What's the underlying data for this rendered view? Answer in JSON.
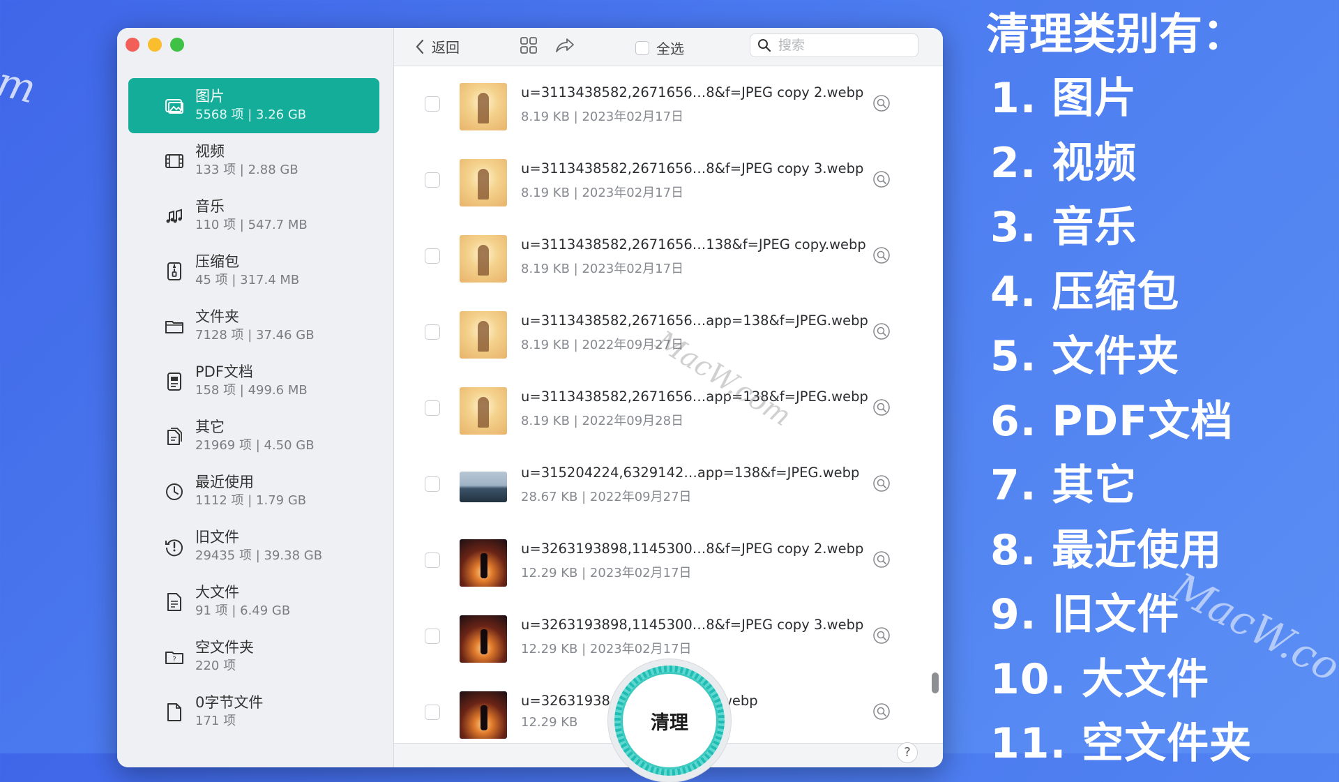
{
  "sidebar": {
    "categories": [
      {
        "name": "图片",
        "meta": "5568 项 | 3.26 GB",
        "icon": "photos-icon",
        "active": true
      },
      {
        "name": "视频",
        "meta": "133 项 | 2.88 GB",
        "icon": "film-icon"
      },
      {
        "name": "音乐",
        "meta": "110 项 | 547.7 MB",
        "icon": "music-note-icon"
      },
      {
        "name": "压缩包",
        "meta": "45 项 | 317.4 MB",
        "icon": "archive-icon"
      },
      {
        "name": "文件夹",
        "meta": "7128 项 | 37.46 GB",
        "icon": "folder-icon"
      },
      {
        "name": "PDF文档",
        "meta": "158 项 | 499.6 MB",
        "icon": "pdf-doc-icon"
      },
      {
        "name": "其它",
        "meta": "21969 项 | 4.50 GB",
        "icon": "documents-icon"
      },
      {
        "name": "最近使用",
        "meta": "1112 项 | 1.79 GB",
        "icon": "clock-icon"
      },
      {
        "name": "旧文件",
        "meta": "29435 项 | 39.38 GB",
        "icon": "history-icon"
      },
      {
        "name": "大文件",
        "meta": "91 项 | 6.49 GB",
        "icon": "large-file-icon"
      },
      {
        "name": "空文件夹",
        "meta": "220 项",
        "icon": "empty-folder-icon"
      },
      {
        "name": "0字节文件",
        "meta": "171 项",
        "icon": "zero-byte-file-icon"
      }
    ]
  },
  "toolbar": {
    "back_label": "返回",
    "select_all_label": "全选",
    "search_placeholder": "搜索"
  },
  "files": [
    {
      "name": "u=3113438582,2671656…8&f=JPEG copy 2.webp",
      "meta": "8.19 KB | 2023年02月17日",
      "thumb": "warm"
    },
    {
      "name": "u=3113438582,2671656…8&f=JPEG copy 3.webp",
      "meta": "8.19 KB | 2023年02月17日",
      "thumb": "warm"
    },
    {
      "name": "u=3113438582,2671656…138&f=JPEG copy.webp",
      "meta": "8.19 KB | 2023年02月17日",
      "thumb": "warm"
    },
    {
      "name": "u=3113438582,2671656…app=138&f=JPEG.webp",
      "meta": "8.19 KB | 2022年09月27日",
      "thumb": "warm"
    },
    {
      "name": "u=3113438582,2671656…app=138&f=JPEG.webp",
      "meta": "8.19 KB | 2022年09月28日",
      "thumb": "warm"
    },
    {
      "name": "u=315204224,6329142…app=138&f=JPEG.webp",
      "meta": "28.67 KB | 2022年09月27日",
      "thumb": "sea"
    },
    {
      "name": "u=3263193898,1145300…8&f=JPEG copy 2.webp",
      "meta": "12.29 KB | 2023年02月17日",
      "thumb": "sunset"
    },
    {
      "name": "u=3263193898,1145300…8&f=JPEG copy 3.webp",
      "meta": "12.29 KB | 2023年02月17日",
      "thumb": "sunset"
    },
    {
      "name": "u=32631938…&f=JPEG copy.webp",
      "meta": "12.29 KB",
      "thumb": "sunset"
    }
  ],
  "clean_button_label": "清理",
  "help_label": "?",
  "watermarks": {
    "left": "m",
    "middle": "MacW.com",
    "right": "MacW.co"
  },
  "right_panel": {
    "title": "清理类别有：",
    "items": [
      "1. 图片",
      "2. 视频",
      "3. 音乐",
      "4. 压缩包",
      "5. 文件夹",
      "6. PDF文档",
      "7. 其它",
      "8. 最近使用",
      "9. 旧文件",
      "10. 大文件",
      "11. 空文件夹"
    ]
  },
  "colors": {
    "accent": "#13ad9a",
    "background": "#4a78ee",
    "clean_ring": "#21bcb3"
  }
}
